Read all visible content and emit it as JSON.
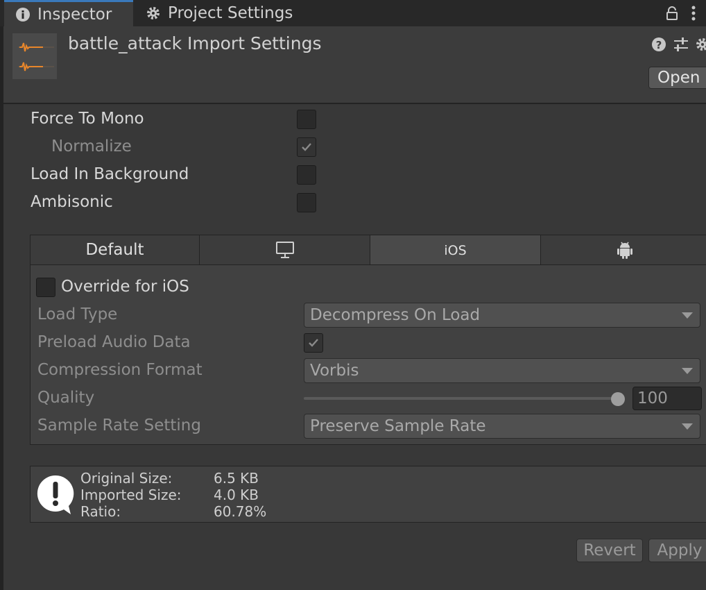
{
  "tabs": {
    "inspector": "Inspector",
    "project_settings": "Project Settings"
  },
  "header": {
    "title": "battle_attack Import Settings",
    "open_button": "Open",
    "icons": [
      "help-icon",
      "preset-icon",
      "settings-icon",
      "lock-icon",
      "more-icon"
    ]
  },
  "properties": {
    "force_to_mono": {
      "label": "Force To Mono",
      "checked": false
    },
    "normalize": {
      "label": "Normalize",
      "checked": true,
      "disabled": true
    },
    "load_in_background": {
      "label": "Load In Background",
      "checked": false
    },
    "ambisonic": {
      "label": "Ambisonic",
      "checked": false
    }
  },
  "platform_tabs": {
    "default": "Default",
    "standalone_icon": "monitor-icon",
    "ios": "iOS",
    "android_icon": "android-icon",
    "active": "iOS"
  },
  "override": {
    "label": "Override for iOS",
    "checked": false
  },
  "settings": {
    "load_type": {
      "label": "Load Type",
      "value": "Decompress On Load"
    },
    "preload_audio_data": {
      "label": "Preload Audio Data",
      "checked": true
    },
    "compression_format": {
      "label": "Compression Format",
      "value": "Vorbis"
    },
    "quality": {
      "label": "Quality",
      "value": "100",
      "level": 1.0
    },
    "sample_rate_setting": {
      "label": "Sample Rate Setting",
      "value": "Preserve Sample Rate"
    }
  },
  "info": {
    "original_size_label": "Original Size:",
    "original_size_value": "6.5 KB",
    "imported_size_label": "Imported Size:",
    "imported_size_value": "4.0 KB",
    "ratio_label": "Ratio:",
    "ratio_value": "60.78%"
  },
  "buttons": {
    "revert": "Revert",
    "apply": "Apply"
  },
  "colors": {
    "accent": "#3a79bb",
    "waveform": "#e8862a",
    "background": "#383838"
  }
}
